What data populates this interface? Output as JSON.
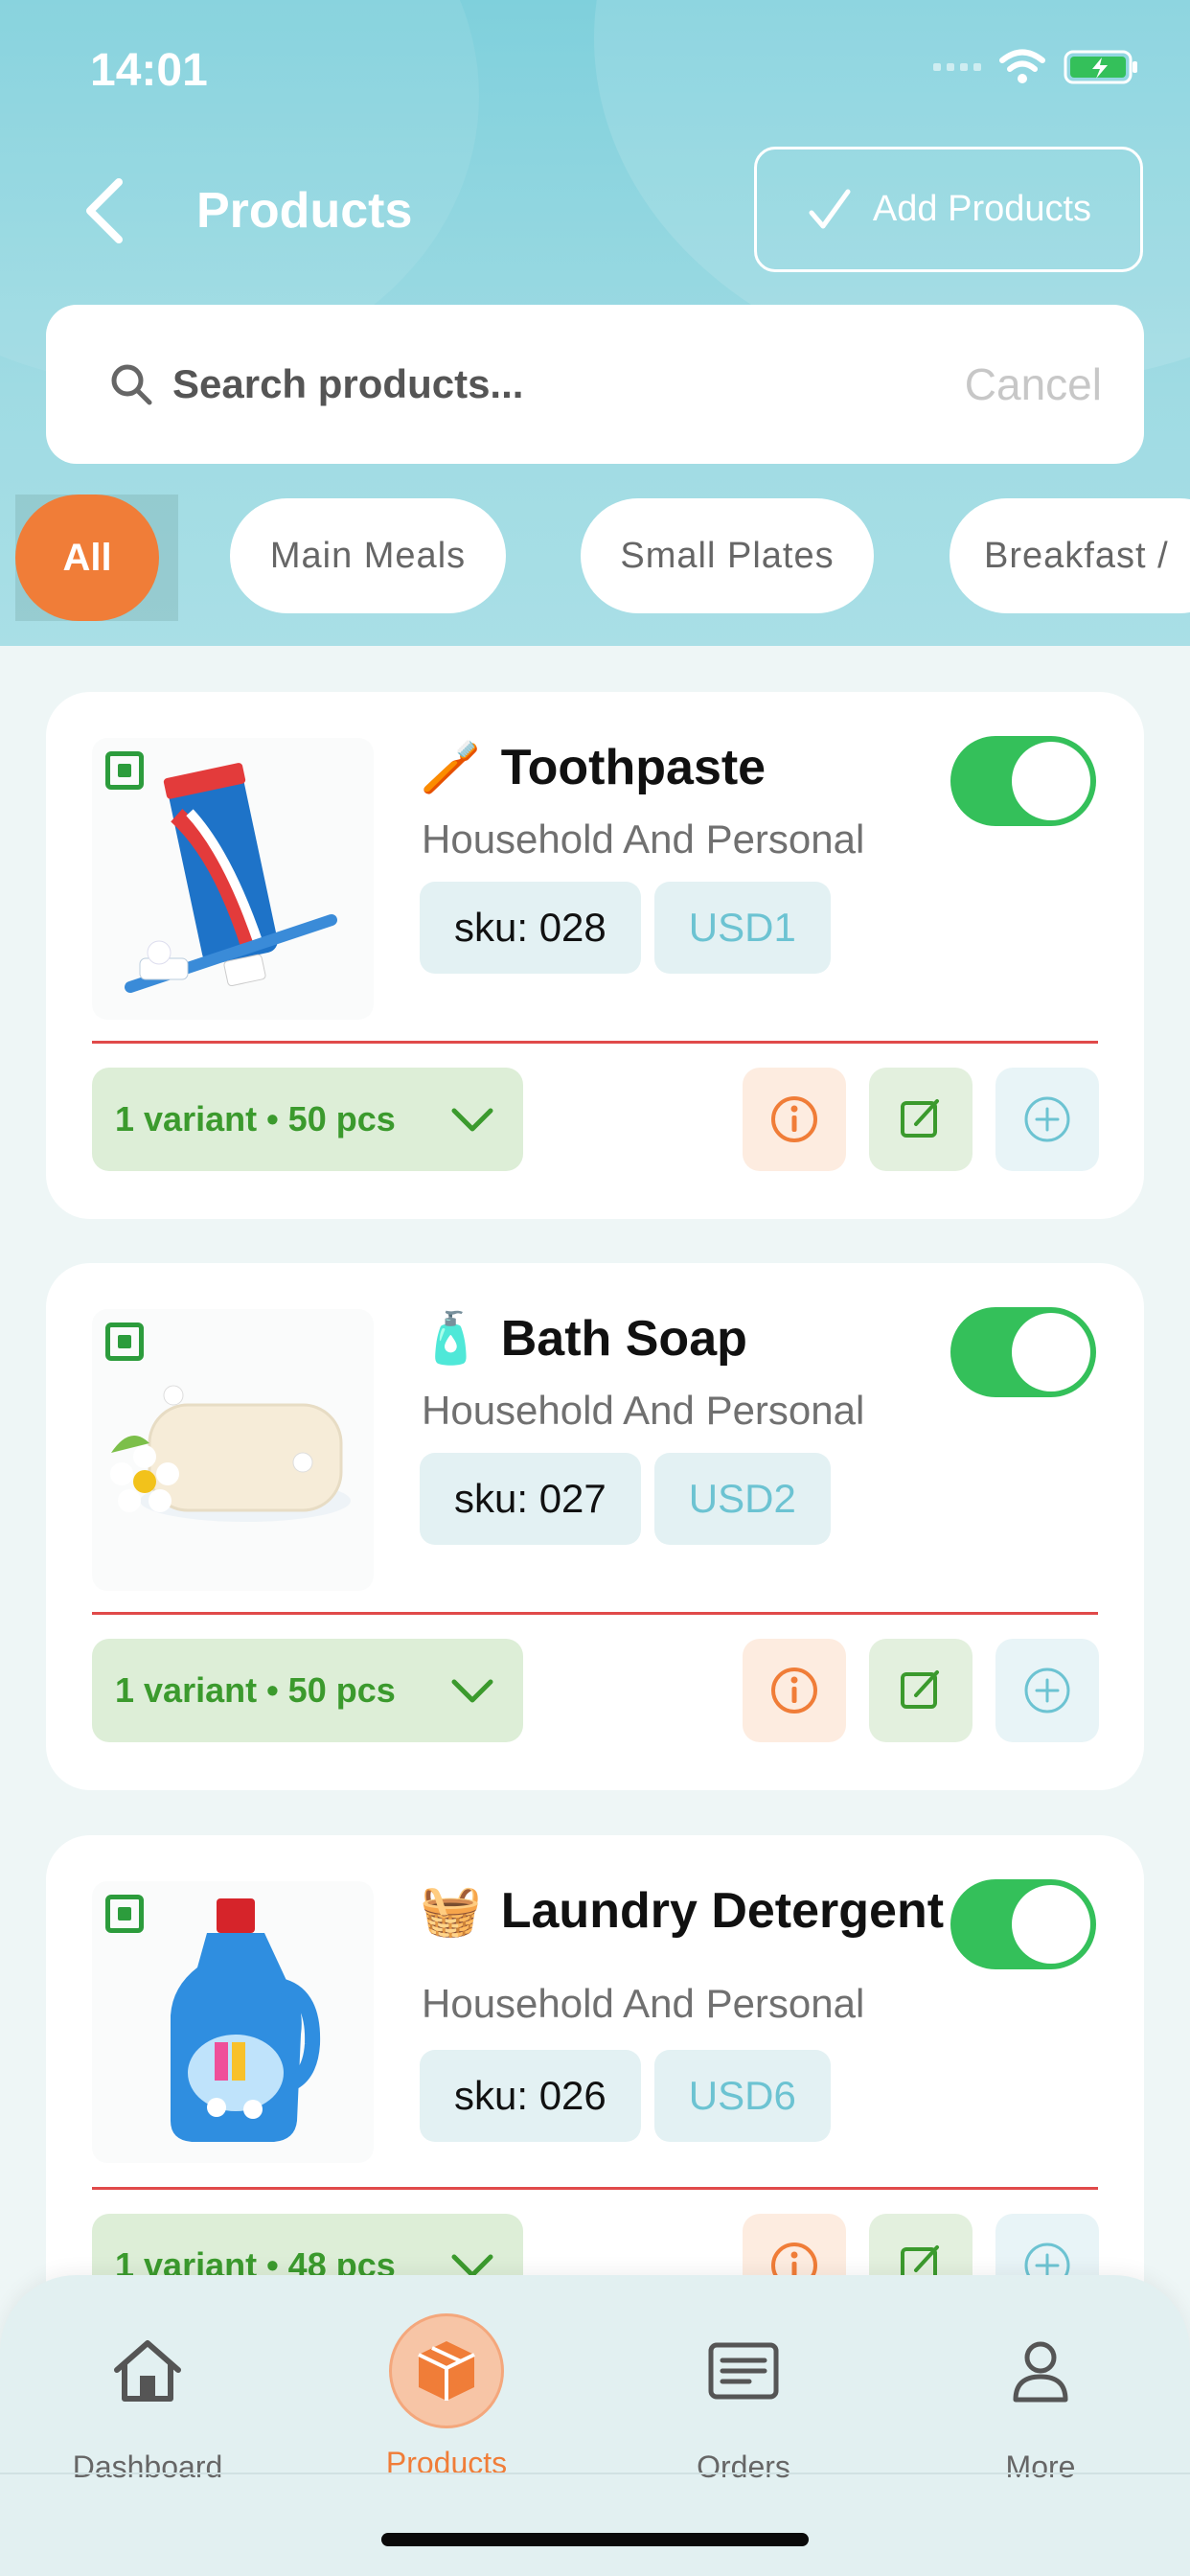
{
  "status": {
    "time": "14:01"
  },
  "header": {
    "title": "Products",
    "add_label": "Add Products"
  },
  "search": {
    "placeholder": "Search products...",
    "cancel_label": "Cancel"
  },
  "filters": [
    "All",
    "Main Meals",
    "Small Plates",
    "Breakfast /"
  ],
  "products": [
    {
      "emoji": "🪥",
      "name": "Toothpaste",
      "category": "Household And Personal",
      "sku": "sku: 028",
      "price": "USD1",
      "variants": "1 variant • 50 pcs",
      "enabled": true
    },
    {
      "emoji": "🧴",
      "name": "Bath Soap",
      "category": "Household And Personal",
      "sku": "sku: 027",
      "price": "USD2",
      "variants": "1 variant • 50 pcs",
      "enabled": true
    },
    {
      "emoji": "🧺",
      "name": "Laundry Detergent",
      "category": "Household And Personal",
      "sku": "sku: 026",
      "price": "USD6",
      "variants": "1 variant • 48 pcs",
      "enabled": true
    }
  ],
  "tabs": [
    {
      "label": "Dashboard",
      "icon": "home-icon"
    },
    {
      "label": "Products",
      "icon": "box-icon"
    },
    {
      "label": "Orders",
      "icon": "list-icon"
    },
    {
      "label": "More",
      "icon": "user-icon"
    }
  ],
  "colors": {
    "accent": "#f07d38",
    "toggle_on": "#34c05a",
    "variant_text": "#3b9a2d",
    "price_text": "#6cc3d2"
  }
}
